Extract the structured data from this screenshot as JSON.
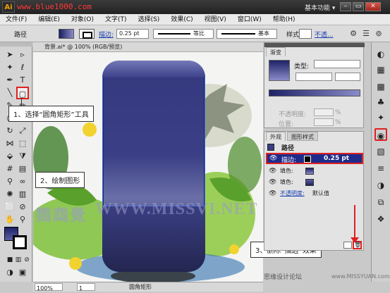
{
  "window": {
    "logo_text": "Ai",
    "watermark_site": "www.blue1000.com",
    "workspace_label": "基本功能 ▾",
    "min_symbol": "–",
    "max_symbol": "▭",
    "close_symbol": "✕"
  },
  "menu": [
    "文件(F)",
    "编辑(E)",
    "对象(O)",
    "文字(T)",
    "选择(S)",
    "效果(C)",
    "视图(V)",
    "窗口(W)",
    "帮助(H)"
  ],
  "controlbar": {
    "object_type": "路径",
    "stroke_label": "描边:",
    "stroke_value": "0.25 pt",
    "profile_label": "等比",
    "brush_label": "基本",
    "style_label": "样式:",
    "opacity_label": "不透..."
  },
  "document": {
    "tab_title": "背景.ai* @ 100% (RGB/预览)",
    "zoom": "100%",
    "page": "1",
    "status_tool": "圆角矩形"
  },
  "callouts": {
    "step1": "1、选择“圆角矩形”工具",
    "step2": "2、绘制图形",
    "step3": "3、删除“描边”效果"
  },
  "canvas_watermark": "WWW.MISSVI.NET",
  "canvas_watermark_cn": "鸚鵡覺",
  "gradient_panel": {
    "tab": "渐变",
    "type_label": "类型:",
    "opacity_label": "不透明度:",
    "position_label": "位置:",
    "percent": "%"
  },
  "appearance_panel": {
    "tab1": "外观",
    "tab2": "图形样式",
    "header": "路径",
    "rows": [
      {
        "label": "描边:",
        "value": "0.25 pt"
      },
      {
        "label": "填色:",
        "value": ""
      },
      {
        "label": "填色:",
        "value": ""
      },
      {
        "label": "不透明度:",
        "value": "默认值"
      }
    ]
  },
  "footer_brand": "思缘设计论坛",
  "footer_domain": "www.MISSYUAN.com",
  "colors": {
    "callout_border": "#e02020",
    "highlight": "#e02020",
    "phone_top": "#7479b8",
    "phone_body": "#34387d",
    "selection_row": "#1f2b8a"
  }
}
